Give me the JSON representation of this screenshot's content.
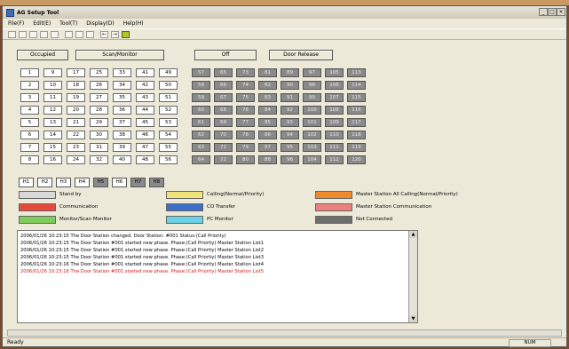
{
  "window": {
    "title": "AG Setup Tool"
  },
  "menu": [
    "File(F)",
    "Edit(E)",
    "Tool(T)",
    "Display(D)",
    "Help(H)"
  ],
  "buttons": {
    "occupied": "Occupied",
    "scan_monitor": "Scan/Monitor",
    "off": "Off",
    "door_release": "Door Release"
  },
  "grid_white": [
    [
      "1",
      "9",
      "17",
      "25",
      "33",
      "41",
      "49"
    ],
    [
      "2",
      "10",
      "18",
      "26",
      "34",
      "42",
      "50"
    ],
    [
      "3",
      "11",
      "19",
      "27",
      "35",
      "43",
      "51"
    ],
    [
      "4",
      "12",
      "20",
      "28",
      "36",
      "44",
      "52"
    ],
    [
      "5",
      "13",
      "21",
      "29",
      "37",
      "45",
      "53"
    ],
    [
      "6",
      "14",
      "22",
      "30",
      "38",
      "46",
      "54"
    ],
    [
      "7",
      "15",
      "23",
      "31",
      "39",
      "47",
      "55"
    ],
    [
      "8",
      "16",
      "24",
      "32",
      "40",
      "48",
      "56"
    ]
  ],
  "grid_gray": [
    [
      "57",
      "65",
      "73",
      "81",
      "89",
      "97",
      "105",
      "113"
    ],
    [
      "58",
      "66",
      "74",
      "82",
      "90",
      "98",
      "106",
      "114"
    ],
    [
      "59",
      "67",
      "75",
      "83",
      "91",
      "99",
      "107",
      "115"
    ],
    [
      "60",
      "68",
      "76",
      "84",
      "92",
      "100",
      "108",
      "116"
    ],
    [
      "61",
      "69",
      "77",
      "85",
      "93",
      "101",
      "109",
      "117"
    ],
    [
      "62",
      "70",
      "78",
      "86",
      "94",
      "102",
      "110",
      "118"
    ],
    [
      "63",
      "71",
      "79",
      "87",
      "95",
      "103",
      "111",
      "119"
    ],
    [
      "64",
      "72",
      "80",
      "88",
      "96",
      "104",
      "112",
      "120"
    ]
  ],
  "h_cells": [
    {
      "label": "H1",
      "color": "#ffffff"
    },
    {
      "label": "H2",
      "color": "#ffffff"
    },
    {
      "label": "H3",
      "color": "#ffffff"
    },
    {
      "label": "H4",
      "color": "#ffffff"
    },
    {
      "label": "H5",
      "color": "#8a8a8a"
    },
    {
      "label": "H6",
      "color": "#ffffff"
    },
    {
      "label": "H7",
      "color": "#8a8a8a"
    },
    {
      "label": "H8",
      "color": "#8a8a8a"
    }
  ],
  "legend": [
    {
      "label": "Stand by",
      "color": "#d8d8d8"
    },
    {
      "label": "Communication",
      "color": "#e8483a"
    },
    {
      "label": "Monitor/Scan Monitor",
      "color": "#7fcc5a"
    },
    {
      "label": "Calling(Normal/Priority)",
      "color": "#f2e27a"
    },
    {
      "label": "CO Transfer",
      "color": "#3a6ec8"
    },
    {
      "label": "PC Monitor",
      "color": "#6ad2e6"
    },
    {
      "label": "Master Station All Calling(Normal/Priority)",
      "color": "#f08a2a"
    },
    {
      "label": "Master Station Communication",
      "color": "#ef8080"
    },
    {
      "label": "Not Connected",
      "color": "#6e6e6e"
    }
  ],
  "log": [
    {
      "text": "2006/01/26 10:23:15 The Door Station changed. Door Station: #001 Status:(Call Priority)",
      "color": "#000000"
    },
    {
      "text": "2006/01/26 10:23:15 The Door Station #001 started new phase. Phase:(Call Priority) Master Station List1",
      "color": "#000000"
    },
    {
      "text": "2006/01/26 10:23:15 The Door Station #001 started new phase. Phase:(Call Priority) Master Station List2",
      "color": "#000000"
    },
    {
      "text": "2006/01/26 10:23:15 The Door Station #001 started new phase. Phase:(Call Priority) Master Station List3",
      "color": "#000000"
    },
    {
      "text": "2006/01/26 10:23:16 The Door Station #001 started new phase. Phase:(Call Priority) Master Station List4",
      "color": "#000000"
    },
    {
      "text": "2006/01/26 10:23:16 The Door Station #001 started new phase. Phase:(Call Priority) Master Station List5",
      "color": "#d02020"
    }
  ],
  "status": {
    "left": "Ready",
    "right": "NUM"
  }
}
